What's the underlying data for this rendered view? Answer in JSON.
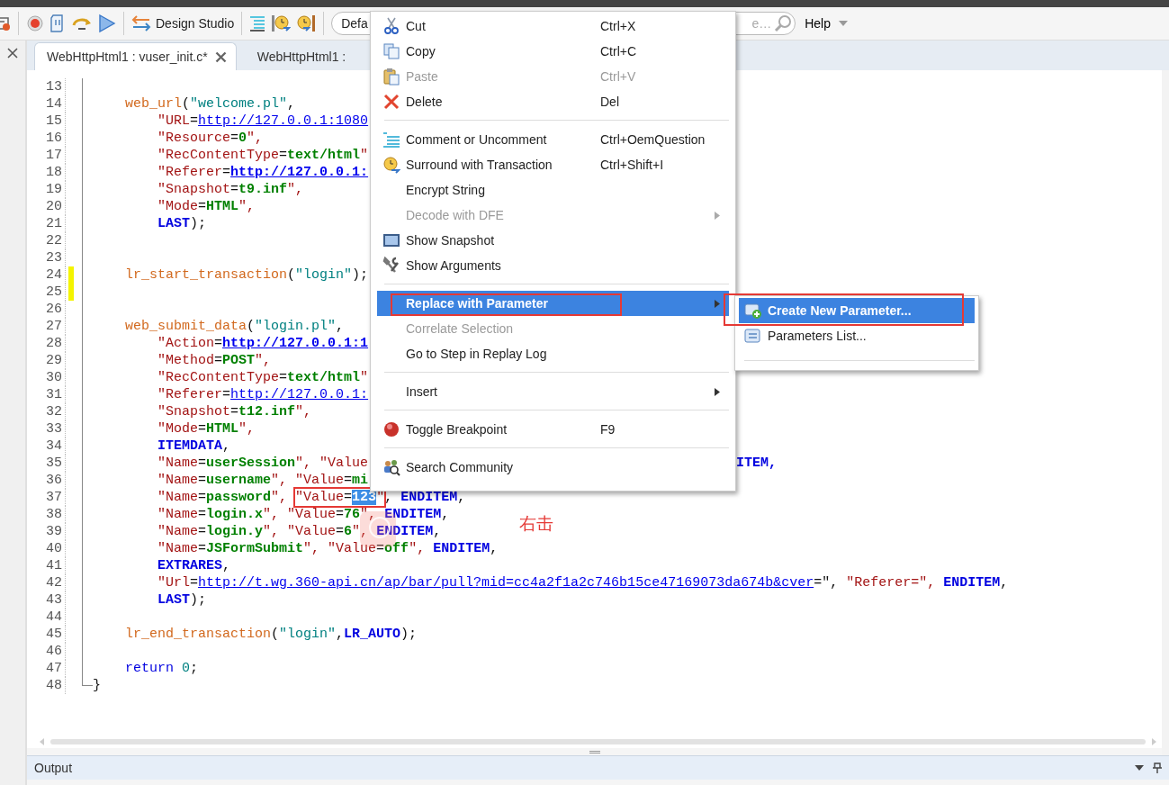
{
  "toolbar": {
    "design_studio": "Design Studio",
    "combo": "Defa",
    "search": {
      "placeholder": "e…"
    },
    "help": "Help"
  },
  "tabs": [
    {
      "label": "WebHttpHtml1 : vuser_init.c*",
      "selected": true,
      "closable": true
    },
    {
      "label": "WebHttpHtml1 :",
      "selected": false,
      "closable": false
    }
  ],
  "editor": {
    "lines": [
      {
        "n": "13",
        "changed": false
      },
      {
        "n": "14",
        "changed": false,
        "tokens": [
          {
            "kind": "fn",
            "text": "    web_url"
          },
          {
            "kind": "p",
            "text": "("
          },
          {
            "kind": "str",
            "text": "\"welcome.pl\""
          },
          {
            "kind": "p",
            "text": ","
          }
        ]
      },
      {
        "n": "15",
        "changed": false,
        "tokens": [
          {
            "kind": "key",
            "text": "        \"URL"
          },
          {
            "kind": "p",
            "text": "="
          },
          {
            "kind": "link",
            "text": "http://127.0.0.1:1080"
          }
        ]
      },
      {
        "n": "16",
        "changed": false,
        "tokens": [
          {
            "kind": "key",
            "text": "        \"Resource"
          },
          {
            "kind": "p",
            "text": "="
          },
          {
            "kind": "val",
            "text": "0"
          },
          {
            "kind": "key",
            "text": "\","
          }
        ]
      },
      {
        "n": "17",
        "changed": false,
        "tokens": [
          {
            "kind": "key",
            "text": "        \"RecContentType"
          },
          {
            "kind": "p",
            "text": "="
          },
          {
            "kind": "val",
            "text": "text/html"
          },
          {
            "kind": "key",
            "text": "\""
          }
        ]
      },
      {
        "n": "18",
        "changed": false,
        "tokens": [
          {
            "kind": "key",
            "text": "        \"Referer"
          },
          {
            "kind": "p",
            "text": "="
          },
          {
            "kind": "linkb",
            "text": "http://127.0.0.1:"
          }
        ]
      },
      {
        "n": "19",
        "changed": false,
        "tokens": [
          {
            "kind": "key",
            "text": "        \"Snapshot"
          },
          {
            "kind": "p",
            "text": "="
          },
          {
            "kind": "val",
            "text": "t9.inf"
          },
          {
            "kind": "key",
            "text": "\","
          }
        ]
      },
      {
        "n": "20",
        "changed": false,
        "tokens": [
          {
            "kind": "key",
            "text": "        \"Mode"
          },
          {
            "kind": "p",
            "text": "="
          },
          {
            "kind": "val",
            "text": "HTML"
          },
          {
            "kind": "key",
            "text": "\","
          }
        ]
      },
      {
        "n": "21",
        "changed": false,
        "tokens": [
          {
            "kind": "const",
            "text": "        LAST"
          },
          {
            "kind": "p",
            "text": ");"
          }
        ]
      },
      {
        "n": "22",
        "changed": false
      },
      {
        "n": "23",
        "changed": false
      },
      {
        "n": "24",
        "changed": true,
        "tokens": [
          {
            "kind": "fn",
            "text": "    lr_start_transaction"
          },
          {
            "kind": "p",
            "text": "("
          },
          {
            "kind": "str",
            "text": "\"login\""
          },
          {
            "kind": "p",
            "text": ");"
          }
        ]
      },
      {
        "n": "25",
        "changed": true
      },
      {
        "n": "26",
        "changed": false
      },
      {
        "n": "27",
        "changed": false,
        "tokens": [
          {
            "kind": "fn",
            "text": "    web_submit_data"
          },
          {
            "kind": "p",
            "text": "("
          },
          {
            "kind": "str",
            "text": "\"login.pl\""
          },
          {
            "kind": "p",
            "text": ","
          }
        ]
      },
      {
        "n": "28",
        "changed": false,
        "tokens": [
          {
            "kind": "key",
            "text": "        \"Action"
          },
          {
            "kind": "p",
            "text": "="
          },
          {
            "kind": "linkb",
            "text": "http://127.0.0.1:1"
          }
        ]
      },
      {
        "n": "29",
        "changed": false,
        "tokens": [
          {
            "kind": "key",
            "text": "        \"Method"
          },
          {
            "kind": "p",
            "text": "="
          },
          {
            "kind": "val",
            "text": "POST"
          },
          {
            "kind": "key",
            "text": "\","
          }
        ]
      },
      {
        "n": "30",
        "changed": false,
        "tokens": [
          {
            "kind": "key",
            "text": "        \"RecContentType"
          },
          {
            "kind": "p",
            "text": "="
          },
          {
            "kind": "val",
            "text": "text/html"
          },
          {
            "kind": "key",
            "text": "\""
          }
        ]
      },
      {
        "n": "31",
        "changed": false,
        "tokens": [
          {
            "kind": "key",
            "text": "        \"Referer"
          },
          {
            "kind": "p",
            "text": "="
          },
          {
            "kind": "link",
            "text": "http://127.0.0.1:"
          }
        ]
      },
      {
        "n": "32",
        "changed": false,
        "tokens": [
          {
            "kind": "key",
            "text": "        \"Snapshot"
          },
          {
            "kind": "p",
            "text": "="
          },
          {
            "kind": "val",
            "text": "t12.inf"
          },
          {
            "kind": "key",
            "text": "\","
          }
        ]
      },
      {
        "n": "33",
        "changed": false,
        "tokens": [
          {
            "kind": "key",
            "text": "        \"Mode"
          },
          {
            "kind": "p",
            "text": "="
          },
          {
            "kind": "val",
            "text": "HTML"
          },
          {
            "kind": "key",
            "text": "\","
          }
        ]
      },
      {
        "n": "34",
        "changed": false,
        "tokens": [
          {
            "kind": "const",
            "text": "        ITEMDATA"
          },
          {
            "kind": "p",
            "text": ","
          }
        ]
      },
      {
        "n": "35",
        "changed": false,
        "tokens": [
          {
            "kind": "key",
            "text": "        \"Name"
          },
          {
            "kind": "p",
            "text": "="
          },
          {
            "kind": "val",
            "text": "userSession"
          },
          {
            "kind": "key",
            "text": "\", \"Value"
          }
        ],
        "tail": {
          "kind": "const",
          "text": "ITEM,"
        }
      },
      {
        "n": "36",
        "changed": false,
        "tokens": [
          {
            "kind": "key",
            "text": "        \"Name"
          },
          {
            "kind": "p",
            "text": "="
          },
          {
            "kind": "val",
            "text": "username"
          },
          {
            "kind": "key",
            "text": "\", \"Value"
          },
          {
            "kind": "p",
            "text": "="
          },
          {
            "kind": "val",
            "text": "mi"
          }
        ]
      },
      {
        "n": "37",
        "changed": false,
        "tokens": [
          {
            "kind": "key",
            "text": "        \"Name"
          },
          {
            "kind": "p",
            "text": "="
          },
          {
            "kind": "val",
            "text": "password"
          },
          {
            "kind": "key",
            "text": "\", "
          }
        ],
        "box": [
          {
            "kind": "key",
            "text": "\"Value"
          },
          {
            "kind": "p",
            "text": "="
          },
          {
            "kind": "sel",
            "text": "123"
          },
          {
            "kind": "key",
            "text": "\""
          }
        ],
        "after": [
          {
            "kind": "p",
            "text": ", "
          },
          {
            "kind": "const",
            "text": "ENDITEM"
          },
          {
            "kind": "p",
            "text": ","
          }
        ]
      },
      {
        "n": "38",
        "changed": false,
        "tokens": [
          {
            "kind": "key",
            "text": "        \"Name"
          },
          {
            "kind": "p",
            "text": "="
          },
          {
            "kind": "val",
            "text": "login.x"
          },
          {
            "kind": "key",
            "text": "\", \"Value"
          },
          {
            "kind": "p",
            "text": "="
          },
          {
            "kind": "val",
            "text": "76"
          },
          {
            "kind": "key",
            "text": "\", "
          },
          {
            "kind": "const",
            "text": "ENDITEM"
          },
          {
            "kind": "p",
            "text": ","
          }
        ]
      },
      {
        "n": "39",
        "changed": false,
        "tokens": [
          {
            "kind": "key",
            "text": "        \"Name"
          },
          {
            "kind": "p",
            "text": "="
          },
          {
            "kind": "val",
            "text": "login.y"
          },
          {
            "kind": "key",
            "text": "\", \"Value"
          },
          {
            "kind": "p",
            "text": "="
          },
          {
            "kind": "val",
            "text": "6"
          },
          {
            "kind": "key",
            "text": "\", "
          },
          {
            "kind": "const",
            "text": "ENDITEM"
          },
          {
            "kind": "p",
            "text": ","
          }
        ]
      },
      {
        "n": "40",
        "changed": false,
        "tokens": [
          {
            "kind": "key",
            "text": "        \"Name"
          },
          {
            "kind": "p",
            "text": "="
          },
          {
            "kind": "val",
            "text": "JSFormSubmit"
          },
          {
            "kind": "key",
            "text": "\", \"Value"
          },
          {
            "kind": "p",
            "text": "="
          },
          {
            "kind": "val",
            "text": "off"
          },
          {
            "kind": "key",
            "text": "\", "
          },
          {
            "kind": "const",
            "text": "ENDITEM"
          },
          {
            "kind": "p",
            "text": ","
          }
        ]
      },
      {
        "n": "41",
        "changed": false,
        "tokens": [
          {
            "kind": "const",
            "text": "        EXTRARES"
          },
          {
            "kind": "p",
            "text": ","
          }
        ]
      },
      {
        "n": "42",
        "changed": false,
        "tokens": [
          {
            "kind": "key",
            "text": "        \"Url"
          },
          {
            "kind": "p",
            "text": "="
          },
          {
            "kind": "link",
            "text": "http://t.wg.360-api.cn/ap/bar/pull?mid=cc4a2f1a2c746b15ce47169073da674b&cver"
          },
          {
            "kind": "p",
            "text": "=\", "
          },
          {
            "kind": "key",
            "text": "\"Referer=\", "
          },
          {
            "kind": "const",
            "text": "ENDITEM"
          },
          {
            "kind": "p",
            "text": ","
          }
        ]
      },
      {
        "n": "43",
        "changed": false,
        "tokens": [
          {
            "kind": "const",
            "text": "        LAST"
          },
          {
            "kind": "p",
            "text": ");"
          }
        ]
      },
      {
        "n": "44",
        "changed": false
      },
      {
        "n": "45",
        "changed": false,
        "tokens": [
          {
            "kind": "fn",
            "text": "    lr_end_transaction"
          },
          {
            "kind": "p",
            "text": "("
          },
          {
            "kind": "str",
            "text": "\"login\""
          },
          {
            "kind": "p",
            "text": ","
          },
          {
            "kind": "const",
            "text": "LR_AUTO"
          },
          {
            "kind": "p",
            "text": ");"
          }
        ]
      },
      {
        "n": "46",
        "changed": false
      },
      {
        "n": "47",
        "changed": false,
        "tokens": [
          {
            "kind": "kw",
            "text": "    return "
          },
          {
            "kind": "num",
            "text": "0"
          },
          {
            "kind": "p",
            "text": ";"
          }
        ]
      },
      {
        "n": "48",
        "changed": false,
        "tokens": [
          {
            "kind": "p",
            "text": "}"
          }
        ]
      }
    ]
  },
  "context_menu": {
    "items": [
      {
        "kind": "item",
        "label": "Cut",
        "shortcut": "Ctrl+X",
        "disabled": false,
        "selected": false,
        "submenu": false,
        "marked": false
      },
      {
        "kind": "item",
        "label": "Copy",
        "shortcut": "Ctrl+C",
        "disabled": false,
        "selected": false,
        "submenu": false,
        "marked": false
      },
      {
        "kind": "item",
        "label": "Paste",
        "shortcut": "Ctrl+V",
        "disabled": true,
        "selected": false,
        "submenu": false,
        "marked": false
      },
      {
        "kind": "item",
        "label": "Delete",
        "shortcut": "Del",
        "disabled": false,
        "selected": false,
        "submenu": false,
        "marked": false
      },
      {
        "kind": "separator"
      },
      {
        "kind": "item",
        "label": "Comment or Uncomment",
        "shortcut": "Ctrl+OemQuestion",
        "disabled": false,
        "selected": false,
        "submenu": false,
        "marked": false
      },
      {
        "kind": "item",
        "label": "Surround with Transaction",
        "shortcut": "Ctrl+Shift+I",
        "disabled": false,
        "selected": false,
        "submenu": false,
        "marked": false
      },
      {
        "kind": "item",
        "label": "Encrypt String",
        "disabled": false,
        "selected": false,
        "submenu": false,
        "marked": false
      },
      {
        "kind": "item",
        "label": "Decode with DFE",
        "disabled": true,
        "selected": false,
        "submenu": true,
        "marked": false
      },
      {
        "kind": "item",
        "label": "Show Snapshot",
        "disabled": false,
        "selected": false,
        "submenu": false,
        "marked": false
      },
      {
        "kind": "item",
        "label": "Show Arguments",
        "disabled": false,
        "selected": false,
        "submenu": false,
        "marked": false
      },
      {
        "kind": "separator"
      },
      {
        "kind": "item",
        "label": "Replace with Parameter",
        "disabled": false,
        "selected": true,
        "submenu": true,
        "marked": true
      },
      {
        "kind": "item",
        "label": "Correlate Selection",
        "disabled": true,
        "selected": false,
        "submenu": false,
        "marked": false
      },
      {
        "kind": "item",
        "label": "Go to Step in Replay Log",
        "disabled": false,
        "selected": false,
        "submenu": false,
        "marked": false
      },
      {
        "kind": "separator"
      },
      {
        "kind": "item",
        "label": "Insert",
        "disabled": false,
        "selected": false,
        "submenu": true,
        "marked": false
      },
      {
        "kind": "separator"
      },
      {
        "kind": "item",
        "label": "Toggle Breakpoint",
        "shortcut": "F9",
        "disabled": false,
        "selected": false,
        "submenu": false,
        "marked": false
      },
      {
        "kind": "separator"
      },
      {
        "kind": "item",
        "label": "Search Community",
        "disabled": false,
        "selected": false,
        "submenu": false,
        "marked": false
      }
    ]
  },
  "submenu": {
    "items": [
      {
        "kind": "item",
        "label": "Create New Parameter...",
        "selected": true,
        "marked": true
      },
      {
        "kind": "item",
        "label": "Parameters List...",
        "selected": false,
        "marked": false
      },
      {
        "kind": "separator"
      }
    ]
  },
  "annotation": "右击",
  "output_panel": {
    "title": "Output"
  }
}
